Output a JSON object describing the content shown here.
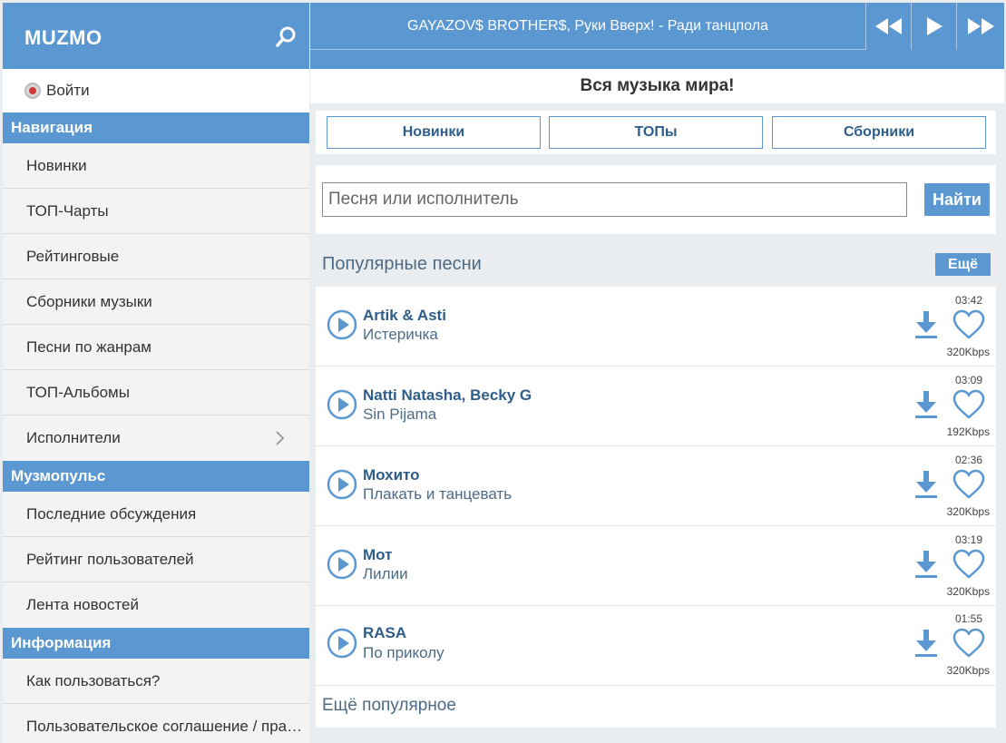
{
  "brand": {
    "logo": "MUZMO"
  },
  "auth": {
    "login_label": "Войти"
  },
  "sidebar": {
    "navigation_title": "Навигация",
    "navigation": [
      "Новинки",
      "ТОП-Чарты",
      "Рейтинговые",
      "Сборники музыки",
      "Песни по жанрам",
      "ТОП-Альбомы",
      "Исполнители"
    ],
    "pulse_title": "Музмопульс",
    "pulse": [
      "Последние обсуждения",
      "Рейтинг пользователей",
      "Лента новостей"
    ],
    "info_title": "Информация",
    "info": [
      "Как пользоваться?",
      "Пользовательское соглашение / правообладателям"
    ]
  },
  "player": {
    "now_playing": "GAYAZOV$ BROTHER$, Руки Вверх! - Ради танцпола"
  },
  "header": {
    "tagline": "Вся музыка мира!"
  },
  "tabs": [
    "Новинки",
    "ТОПы",
    "Сборники"
  ],
  "search": {
    "placeholder": "Песня или исполнитель",
    "button": "Найти"
  },
  "popular": {
    "title": "Популярные песни",
    "more_button": "Ещё",
    "more_link": "Ещё популярное",
    "songs": [
      {
        "artist": "Artik & Asti",
        "title": "Истеричка",
        "duration": "03:42",
        "bitrate": "320Kbps"
      },
      {
        "artist": "Natti Natasha, Becky G",
        "title": "Sin Pijama",
        "duration": "03:09",
        "bitrate": "192Kbps"
      },
      {
        "artist": "Мохито",
        "title": "Плакать и танцевать",
        "duration": "02:36",
        "bitrate": "320Kbps"
      },
      {
        "artist": "Мот",
        "title": "Лилии",
        "duration": "03:19",
        "bitrate": "320Kbps"
      },
      {
        "artist": "RASA",
        "title": "По приколу",
        "duration": "01:55",
        "bitrate": "320Kbps"
      }
    ]
  },
  "colors": {
    "accent": "#5b97d1",
    "link": "#2f5d8a",
    "text_muted": "#4d6b85",
    "background": "#e9edf0"
  },
  "icons": {
    "search": "search-icon",
    "login": "record-dot-icon",
    "chevron": "chevron-right-icon",
    "prev": "rewind-icon",
    "play": "play-icon",
    "next": "fast-forward-icon",
    "download": "download-icon",
    "favorite": "heart-icon"
  }
}
